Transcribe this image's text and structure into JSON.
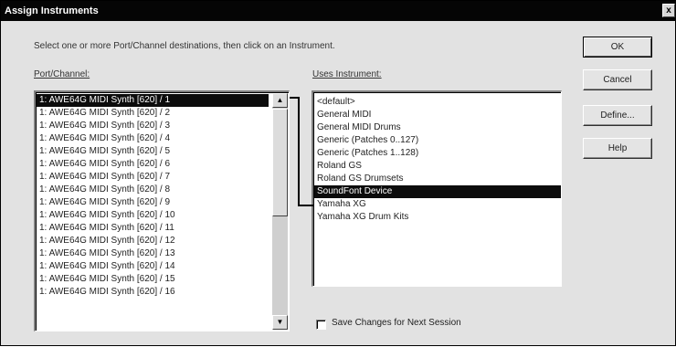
{
  "window": {
    "title": "Assign Instruments",
    "close_glyph": "x"
  },
  "instruction": "Select one or more Port/Channel destinations, then click on an Instrument.",
  "port_list": {
    "label": "Port/Channel:",
    "items": [
      "1: AWE64G MIDI Synth [620] / 1",
      "1: AWE64G MIDI Synth [620] / 2",
      "1: AWE64G MIDI Synth [620] / 3",
      "1: AWE64G MIDI Synth [620] / 4",
      "1: AWE64G MIDI Synth [620] / 5",
      "1: AWE64G MIDI Synth [620] / 6",
      "1: AWE64G MIDI Synth [620] / 7",
      "1: AWE64G MIDI Synth [620] / 8",
      "1: AWE64G MIDI Synth [620] / 9",
      "1: AWE64G MIDI Synth [620] / 10",
      "1: AWE64G MIDI Synth [620] / 11",
      "1: AWE64G MIDI Synth [620] / 12",
      "1: AWE64G MIDI Synth [620] / 13",
      "1: AWE64G MIDI Synth [620] / 14",
      "1: AWE64G MIDI Synth [620] / 15",
      "1: AWE64G MIDI Synth [620] / 16"
    ],
    "selected_index": 0
  },
  "instrument_list": {
    "label": "Uses Instrument:",
    "items": [
      "<default>",
      "General MIDI",
      "General MIDI Drums",
      "Generic (Patches 0..127)",
      "Generic (Patches 1..128)",
      "Roland GS",
      "Roland GS Drumsets",
      "SoundFont Device",
      "Yamaha XG",
      "Yamaha XG Drum Kits"
    ],
    "selected_index": 7
  },
  "buttons": {
    "ok": "OK",
    "cancel": "Cancel",
    "define": "Define...",
    "help": "Help"
  },
  "save_changes": {
    "label": "Save Changes for Next Session",
    "checked": false
  },
  "icons": {
    "scroll_up": "scroll-up-arrow-icon",
    "scroll_down": "scroll-down-arrow-icon",
    "close": "close-icon"
  }
}
